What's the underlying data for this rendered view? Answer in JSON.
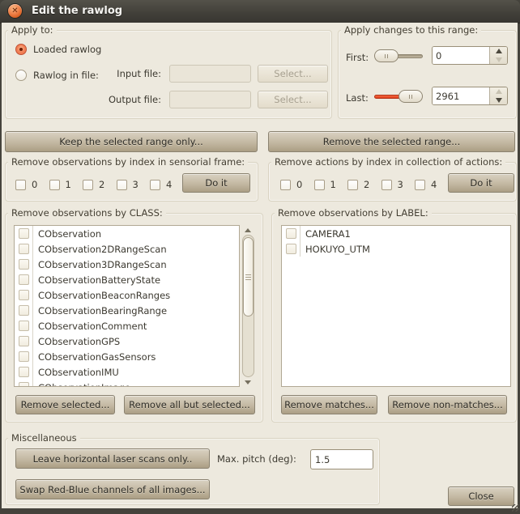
{
  "window": {
    "title": "Edit the rawlog",
    "close_glyph": "✕"
  },
  "apply_to": {
    "legend": "Apply to:",
    "loaded_radio_label": "Loaded rawlog",
    "file_radio_label": "Rawlog in file:",
    "input_file_label": "Input file:",
    "output_file_label": "Output file:",
    "input_file_value": "",
    "output_file_value": "",
    "input_select_label": "Select...",
    "output_select_label": "Select..."
  },
  "range": {
    "legend": "Apply changes to this range:",
    "first_label": "First:",
    "first_value": "0",
    "last_label": "Last:",
    "last_value": "2961"
  },
  "range_actions": {
    "keep_label": "Keep the selected range only...",
    "remove_label": "Remove the selected range..."
  },
  "sensorial": {
    "legend": "Remove observations by index in sensorial frame:",
    "indices": [
      "0",
      "1",
      "2",
      "3",
      "4"
    ],
    "doit_label": "Do it"
  },
  "actions": {
    "legend": "Remove actions by index in collection of actions:",
    "indices": [
      "0",
      "1",
      "2",
      "3",
      "4"
    ],
    "doit_label": "Do it"
  },
  "by_class": {
    "legend": "Remove observations by CLASS:",
    "items": [
      "CObservation",
      "CObservation2DRangeScan",
      "CObservation3DRangeScan",
      "CObservationBatteryState",
      "CObservationBeaconRanges",
      "CObservationBearingRange",
      "CObservationComment",
      "CObservationGPS",
      "CObservationGasSensors",
      "CObservationIMU",
      "CObservationImage"
    ],
    "remove_selected_label": "Remove selected...",
    "remove_all_but_label": "Remove all but selected..."
  },
  "by_label": {
    "legend": "Remove observations by LABEL:",
    "items": [
      "CAMERA1",
      "HOKUYO_UTM"
    ],
    "remove_matches_label": "Remove matches...",
    "remove_non_matches_label": "Remove non-matches..."
  },
  "misc": {
    "legend": "Miscellaneous",
    "leave_horizontal_label": "Leave horizontal laser scans only..",
    "max_pitch_label": "Max. pitch (deg):",
    "max_pitch_value": "1.5",
    "swap_rb_label": "Swap Red-Blue channels of all images..."
  },
  "close_label": "Close",
  "colors": {
    "titlebar": "#3e3c37",
    "dialog_bg": "#EDE9DE",
    "accent_orange": "#EE6F43",
    "slider_fill_red": "#E8471F",
    "button_face": "#C3B8A2"
  }
}
